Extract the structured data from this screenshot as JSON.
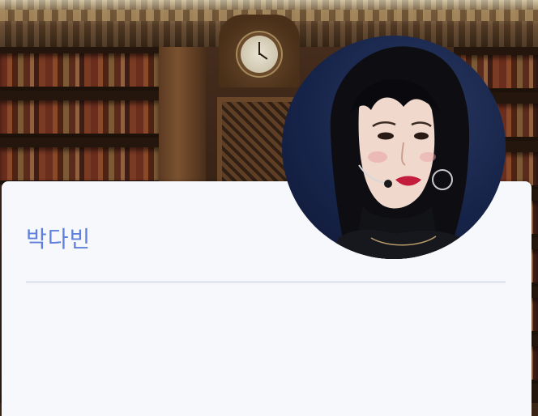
{
  "profile": {
    "name": "박다빈"
  },
  "icons": {
    "avatar": "avatar-photo",
    "background": "library-background"
  },
  "colors": {
    "name_accent": "#5f7fdc",
    "card_background": "#f6f8fb",
    "divider": "#e1e6ef"
  }
}
